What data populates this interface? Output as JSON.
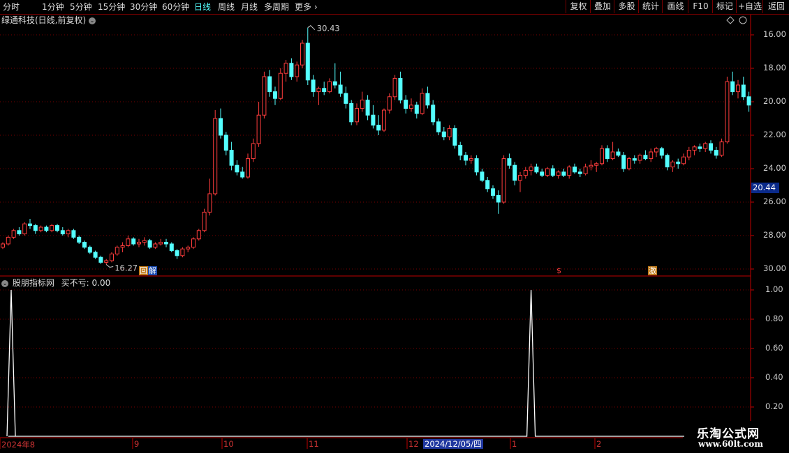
{
  "toolbar": {
    "timeframes": [
      "分时",
      "1分钟",
      "5分钟",
      "15分钟",
      "30分钟",
      "60分钟",
      "日线",
      "周线",
      "月线",
      "多周期",
      "更多"
    ],
    "active_timeframe": "日线",
    "right_buttons": [
      "复权",
      "叠加",
      "多股",
      "统计",
      "画线",
      "F10",
      "标记",
      "+自选",
      "返回"
    ]
  },
  "chart": {
    "title": "绿通科技(日线,前复权)",
    "price_labels": [
      "30.00",
      "28.00",
      "26.00",
      "24.00",
      "22.00",
      "20.00",
      "18.00",
      "16.00"
    ],
    "current_price": "20.44",
    "high_annotation": "30.43",
    "low_annotation": "16.27",
    "markers": {
      "hui": "回",
      "jie": "解",
      "dollar": "$",
      "ji": "激"
    }
  },
  "indicator": {
    "name": "股朋指标网",
    "value_text": "买不亏: 0.00",
    "labels": [
      "1.00",
      "0.80",
      "0.60",
      "0.40",
      "0.20"
    ]
  },
  "date_axis": {
    "labels": [
      "2024年8",
      "9",
      "10",
      "11",
      "12",
      "1",
      "2"
    ],
    "cursor": "2024/12/05/四"
  },
  "logo": {
    "title": "乐淘公式网",
    "url": "www.60lt.com"
  },
  "colors": {
    "up": "#ff3c3c",
    "down": "#54ffff",
    "grid": "#7a0000",
    "axis": "#c00000"
  },
  "chart_data": [
    {
      "type": "candlestick",
      "title": "绿通科技(日线,前复权)",
      "y_range": [
        15.5,
        31.0
      ],
      "y_ticks": [
        16,
        18,
        20,
        22,
        24,
        26,
        28,
        30
      ],
      "x_labels": [
        "2024年8",
        "9",
        "10",
        "11",
        "12",
        "1",
        "2"
      ],
      "candles": [
        [
          17.3,
          17.6,
          17.2,
          17.5
        ],
        [
          17.5,
          18.0,
          17.4,
          17.9
        ],
        [
          17.9,
          18.4,
          17.8,
          18.3
        ],
        [
          18.3,
          18.5,
          18.0,
          18.1
        ],
        [
          18.1,
          18.8,
          18.0,
          18.7
        ],
        [
          18.7,
          19.0,
          18.4,
          18.6
        ],
        [
          18.6,
          18.7,
          18.1,
          18.3
        ],
        [
          18.3,
          18.6,
          18.2,
          18.5
        ],
        [
          18.5,
          18.6,
          18.2,
          18.3
        ],
        [
          18.3,
          18.7,
          18.2,
          18.6
        ],
        [
          18.6,
          18.7,
          18.2,
          18.3
        ],
        [
          18.3,
          18.5,
          18.0,
          18.1
        ],
        [
          18.1,
          18.4,
          17.9,
          18.3
        ],
        [
          18.3,
          18.4,
          17.8,
          17.9
        ],
        [
          17.9,
          18.0,
          17.5,
          17.6
        ],
        [
          17.6,
          17.7,
          17.2,
          17.3
        ],
        [
          17.3,
          17.4,
          16.9,
          17.0
        ],
        [
          17.0,
          17.1,
          16.6,
          16.7
        ],
        [
          16.7,
          16.8,
          16.3,
          16.4
        ],
        [
          16.4,
          16.6,
          16.27,
          16.5
        ],
        [
          16.5,
          17.0,
          16.4,
          16.9
        ],
        [
          16.9,
          17.4,
          16.8,
          17.3
        ],
        [
          17.3,
          17.6,
          17.0,
          17.4
        ],
        [
          17.4,
          18.0,
          17.3,
          17.8
        ],
        [
          17.8,
          17.9,
          17.4,
          17.5
        ],
        [
          17.5,
          17.8,
          17.3,
          17.6
        ],
        [
          17.6,
          17.9,
          17.4,
          17.7
        ],
        [
          17.7,
          17.8,
          17.2,
          17.3
        ],
        [
          17.3,
          17.6,
          17.2,
          17.5
        ],
        [
          17.5,
          17.8,
          17.4,
          17.6
        ],
        [
          17.6,
          17.8,
          17.3,
          17.5
        ],
        [
          17.5,
          17.6,
          17.0,
          17.1
        ],
        [
          17.1,
          17.2,
          16.6,
          16.8
        ],
        [
          16.8,
          17.3,
          16.7,
          17.2
        ],
        [
          17.2,
          17.4,
          17.0,
          17.3
        ],
        [
          17.3,
          17.9,
          17.2,
          17.8
        ],
        [
          17.8,
          18.4,
          17.7,
          18.3
        ],
        [
          18.3,
          19.6,
          18.2,
          19.4
        ],
        [
          19.4,
          21.4,
          19.2,
          20.5
        ],
        [
          20.5,
          25.5,
          20.4,
          25.0
        ],
        [
          25.0,
          25.6,
          23.8,
          24.0
        ],
        [
          24.0,
          24.2,
          22.8,
          23.1
        ],
        [
          23.1,
          23.6,
          21.9,
          22.2
        ],
        [
          22.2,
          22.5,
          21.6,
          21.8
        ],
        [
          21.8,
          22.1,
          21.4,
          21.5
        ],
        [
          21.5,
          22.9,
          21.4,
          22.6
        ],
        [
          22.6,
          23.8,
          22.4,
          23.5
        ],
        [
          23.5,
          26.0,
          23.3,
          25.2
        ],
        [
          25.2,
          27.8,
          25.0,
          27.5
        ],
        [
          27.5,
          27.9,
          26.3,
          26.6
        ],
        [
          26.6,
          26.9,
          25.8,
          26.2
        ],
        [
          26.2,
          28.0,
          26.1,
          27.7
        ],
        [
          27.7,
          28.5,
          27.2,
          28.3
        ],
        [
          28.3,
          28.6,
          27.3,
          27.5
        ],
        [
          27.5,
          28.4,
          27.2,
          28.2
        ],
        [
          28.2,
          29.7,
          28.0,
          29.5
        ],
        [
          29.5,
          30.43,
          27.0,
          27.3
        ],
        [
          27.3,
          27.6,
          26.3,
          26.6
        ],
        [
          26.6,
          26.9,
          25.8,
          26.8
        ],
        [
          26.8,
          27.2,
          26.4,
          26.6
        ],
        [
          26.6,
          27.4,
          26.5,
          27.2
        ],
        [
          27.2,
          28.3,
          26.8,
          27.0
        ],
        [
          27.0,
          27.8,
          26.3,
          26.5
        ],
        [
          26.5,
          26.9,
          25.6,
          25.9
        ],
        [
          25.9,
          26.1,
          24.6,
          24.8
        ],
        [
          24.8,
          25.9,
          24.6,
          25.6
        ],
        [
          25.6,
          26.6,
          25.4,
          26.1
        ],
        [
          26.1,
          26.4,
          24.9,
          25.2
        ],
        [
          25.2,
          25.8,
          24.4,
          24.6
        ],
        [
          24.6,
          25.2,
          24.0,
          24.3
        ],
        [
          24.3,
          25.6,
          24.2,
          25.5
        ],
        [
          25.5,
          26.5,
          25.3,
          26.3
        ],
        [
          26.3,
          27.6,
          26.1,
          27.4
        ],
        [
          27.4,
          27.8,
          25.9,
          26.1
        ],
        [
          26.1,
          26.4,
          25.3,
          25.6
        ],
        [
          25.6,
          26.2,
          25.4,
          25.8
        ],
        [
          25.8,
          26.0,
          25.0,
          25.3
        ],
        [
          25.3,
          26.8,
          25.2,
          26.5
        ],
        [
          26.5,
          26.9,
          25.6,
          25.8
        ],
        [
          25.8,
          26.1,
          24.6,
          24.8
        ],
        [
          24.8,
          25.0,
          24.0,
          24.2
        ],
        [
          24.2,
          24.5,
          23.7,
          23.9
        ],
        [
          23.9,
          24.6,
          23.7,
          24.4
        ],
        [
          24.4,
          24.6,
          23.2,
          23.4
        ],
        [
          23.4,
          23.6,
          22.5,
          22.8
        ],
        [
          22.8,
          23.0,
          22.2,
          22.5
        ],
        [
          22.5,
          22.8,
          22.3,
          22.6
        ],
        [
          22.6,
          22.8,
          21.6,
          21.8
        ],
        [
          21.8,
          22.0,
          21.2,
          21.3
        ],
        [
          21.3,
          21.5,
          20.6,
          20.8
        ],
        [
          20.8,
          21.0,
          20.2,
          20.4
        ],
        [
          20.4,
          20.7,
          19.3,
          20.0
        ],
        [
          20.0,
          22.8,
          19.9,
          22.6
        ],
        [
          22.6,
          22.9,
          22.0,
          22.2
        ],
        [
          22.2,
          22.4,
          21.0,
          21.3
        ],
        [
          21.3,
          21.8,
          20.6,
          21.6
        ],
        [
          21.6,
          22.1,
          21.4,
          21.9
        ],
        [
          21.9,
          22.3,
          21.6,
          22.1
        ],
        [
          22.1,
          22.3,
          21.7,
          21.8
        ],
        [
          21.8,
          22.0,
          21.5,
          21.6
        ],
        [
          21.6,
          22.1,
          21.5,
          22.0
        ],
        [
          22.0,
          22.2,
          21.5,
          21.6
        ],
        [
          21.6,
          21.9,
          21.4,
          21.8
        ],
        [
          21.8,
          22.0,
          21.5,
          21.6
        ],
        [
          21.6,
          22.2,
          21.4,
          22.1
        ],
        [
          22.1,
          22.3,
          21.7,
          21.8
        ],
        [
          21.8,
          22.0,
          21.5,
          21.7
        ],
        [
          21.7,
          22.3,
          21.6,
          22.1
        ],
        [
          22.1,
          22.5,
          21.9,
          22.2
        ],
        [
          22.2,
          22.4,
          21.8,
          22.3
        ],
        [
          22.3,
          23.4,
          22.2,
          23.2
        ],
        [
          23.2,
          23.4,
          22.4,
          22.6
        ],
        [
          22.6,
          23.6,
          22.5,
          23.0
        ],
        [
          23.0,
          23.2,
          22.7,
          22.8
        ],
        [
          22.8,
          23.0,
          21.8,
          22.0
        ],
        [
          22.0,
          22.7,
          21.9,
          22.6
        ],
        [
          22.6,
          22.8,
          22.3,
          22.5
        ],
        [
          22.5,
          22.9,
          22.3,
          22.8
        ],
        [
          22.8,
          23.1,
          22.5,
          22.6
        ],
        [
          22.6,
          23.2,
          22.4,
          23.0
        ],
        [
          23.0,
          23.3,
          22.7,
          23.2
        ],
        [
          23.2,
          23.3,
          22.6,
          22.8
        ],
        [
          22.8,
          22.9,
          21.9,
          22.1
        ],
        [
          22.1,
          22.5,
          21.8,
          22.4
        ],
        [
          22.4,
          22.6,
          22.0,
          22.3
        ],
        [
          22.3,
          22.9,
          22.2,
          22.7
        ],
        [
          22.7,
          23.3,
          22.5,
          23.1
        ],
        [
          23.1,
          23.4,
          22.8,
          23.3
        ],
        [
          23.3,
          23.5,
          23.0,
          23.2
        ],
        [
          23.2,
          23.6,
          23.0,
          23.5
        ],
        [
          23.5,
          23.7,
          22.9,
          23.1
        ],
        [
          23.1,
          23.3,
          22.6,
          22.8
        ],
        [
          22.8,
          23.8,
          22.7,
          23.6
        ],
        [
          23.6,
          27.5,
          23.5,
          27.2
        ],
        [
          27.2,
          27.8,
          26.4,
          26.6
        ],
        [
          26.6,
          27.3,
          26.2,
          27.0
        ],
        [
          27.0,
          27.5,
          26.1,
          26.3
        ],
        [
          26.3,
          26.6,
          25.4,
          25.8
        ]
      ]
    },
    {
      "type": "line",
      "title": "股朋指标网",
      "y_range": [
        0,
        1.0
      ],
      "y_ticks": [
        1.0,
        0.8,
        0.6,
        0.4,
        0.2
      ],
      "series": [
        {
          "name": "买不亏",
          "spikes": [
            {
              "index": 0,
              "value": 1
            },
            {
              "index": 97,
              "value": 1
            }
          ]
        }
      ]
    }
  ]
}
